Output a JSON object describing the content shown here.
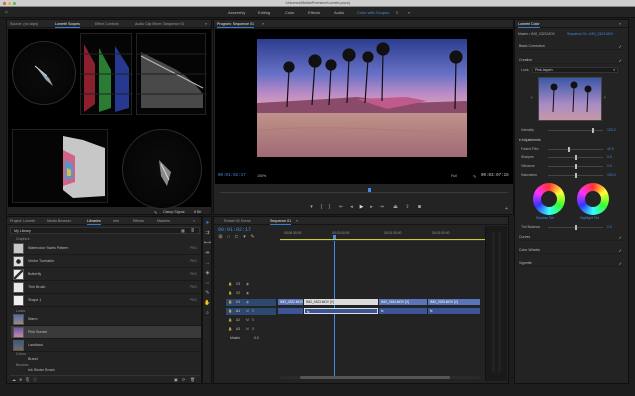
{
  "title": "/Volumes/Media/Premiere/Lumetri.prproj",
  "workspaces": [
    "Assembly",
    "Editing",
    "Color",
    "Effects",
    "Audio",
    "Color with Scopes"
  ],
  "workspace_overflow": "»",
  "scopes_panel": {
    "tabs": [
      "Source: (no clips)",
      "Lumetri Scopes",
      "Effect Controls",
      "Audio Clip Mixer: Sequence 01"
    ],
    "menu": "≡",
    "bottom": {
      "label": "Clamp Signal",
      "bits": "8 Bit"
    }
  },
  "program": {
    "tab": "Program: Sequence 01",
    "menu": "≡",
    "timecode": "00:01:02:17",
    "zoom": "100%",
    "resolution": "Full",
    "duration": "00:03:07:15"
  },
  "project_panel": {
    "tabs": [
      "Project: Lumetri",
      "Media Browser",
      "Libraries",
      "Info",
      "Effects",
      "Markers"
    ],
    "overflow": "»",
    "library_select": "My Library",
    "sections": {
      "graphics": "Graphics",
      "looks": "Looks",
      "colors": "Colors",
      "brushes": "Brushes"
    },
    "graphics": [
      {
        "name": "Watercolor Swirls Pattern",
        "type": "PNG"
      },
      {
        "name": "Vinitor Turntable",
        "type": "PNG"
      },
      {
        "name": "Butterfly",
        "type": "PNG"
      },
      {
        "name": "Thin Brush",
        "type": "PNG"
      },
      {
        "name": "Shape 1",
        "type": "PNG"
      }
    ],
    "looks": [
      {
        "name": "Warm"
      },
      {
        "name": "Pink Sunset"
      },
      {
        "name": "Landland"
      }
    ],
    "colors_item": "Brand",
    "brushes_item": "Ink Stroke Brush"
  },
  "timeline": {
    "tabs": [
      "Rotate 04 Scene",
      "Sequence 01"
    ],
    "menu": "≡",
    "timecode": "00:01:02:17",
    "ruler": [
      "00:00:30:00",
      "00:01:00:00",
      "00:01:30:00",
      "00:02:00:00"
    ],
    "tracks": [
      {
        "name": "V3"
      },
      {
        "name": "V2"
      },
      {
        "name": "V1"
      },
      {
        "name": "A1"
      },
      {
        "name": "A2"
      },
      {
        "name": "A3"
      }
    ],
    "master": {
      "label": "Master",
      "value": "0.0"
    },
    "clips_v1": [
      "IMG_0322.MOV [V]",
      "IMG_0323.MOV [V]",
      "IMG_0324.MOV [V]",
      "IMG_0325.MOV [V]"
    ],
    "clips_a1": [
      "fx",
      "fx",
      "fx"
    ]
  },
  "lumetri": {
    "tab": "Lumetri Color",
    "menu": "≡",
    "header": {
      "master": "Master • IMG_0323.MOV",
      "sequence": "Sequence 01 • IMG_0323.MOV"
    },
    "sections": [
      "Basic Correction",
      "Creative"
    ],
    "look": {
      "label": "Look",
      "value": "Pink Aspen"
    },
    "intensity": {
      "label": "Intensity",
      "value": "123.2"
    },
    "adjustments": "Adjustments",
    "sliders": [
      {
        "label": "Faded Film",
        "value": "40.0"
      },
      {
        "label": "Sharpen",
        "value": "0.0"
      },
      {
        "label": "Vibrance",
        "value": "0.0"
      },
      {
        "label": "Saturation",
        "value": "100.0"
      }
    ],
    "wheels": {
      "shadow": "Shadow Tint",
      "highlight": "Highlight Tint"
    },
    "tint_balance": {
      "label": "Tint Balance",
      "value": "0.0"
    },
    "bottom_sections": [
      "Curves",
      "Color Wheels",
      "Vignette"
    ]
  }
}
